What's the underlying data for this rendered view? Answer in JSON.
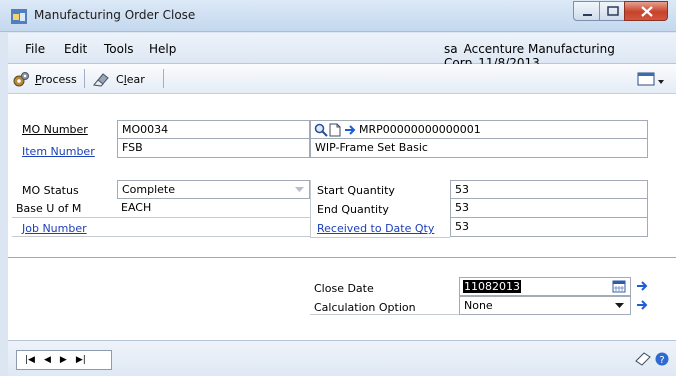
{
  "window": {
    "title": "Manufacturing Order Close"
  },
  "menubar": {
    "items": [
      "File",
      "Edit",
      "Tools",
      "Help"
    ],
    "user": "sa",
    "company": "Accenture Manufacturing Corp",
    "date": "11/8/2013"
  },
  "toolbar": {
    "process_label": "Process",
    "clear_label": "Clear"
  },
  "form": {
    "mo_number": {
      "label": "MO Number",
      "value": "MO0034",
      "reference": "MRP00000000000001"
    },
    "item_number": {
      "label": "Item Number",
      "value": "FSB",
      "description": "WIP-Frame Set Basic"
    },
    "mo_status": {
      "label": "MO Status",
      "value": "Complete"
    },
    "base_uofm": {
      "label": "Base U of M",
      "value": "EACH"
    },
    "job_number": {
      "label": "Job Number",
      "value": ""
    },
    "start_quantity": {
      "label": "Start Quantity",
      "value": "53"
    },
    "end_quantity": {
      "label": "End Quantity",
      "value": "53"
    },
    "received_to_date": {
      "label": "Received to Date Qty",
      "value": "53"
    },
    "close_date": {
      "label": "Close Date",
      "value": "11082013"
    },
    "calculation_option": {
      "label": "Calculation Option",
      "value": "None"
    }
  },
  "icons": {
    "accent": "#1f5bd6",
    "lookup": "magnifier-icon",
    "new": "new-document-icon",
    "go": "arrow-right-icon"
  }
}
